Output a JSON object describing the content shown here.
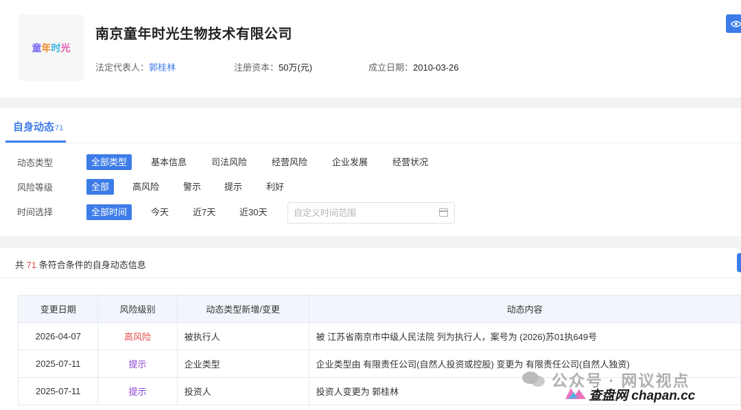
{
  "company": {
    "logo_chars": [
      "童",
      "年",
      "时",
      "光"
    ],
    "name": "南京童年时光生物技术有限公司",
    "legal_rep_label": "法定代表人：",
    "legal_rep": "郭桂林",
    "capital_label": "注册资本：",
    "capital": "50万(元)",
    "founded_label": "成立日期：",
    "founded": "2010-03-26"
  },
  "tab": {
    "label": "自身动态",
    "count": "71"
  },
  "filters": {
    "type_label": "动态类型",
    "type_options": [
      "全部类型",
      "基本信息",
      "司法风险",
      "经营风险",
      "企业发展",
      "经营状况"
    ],
    "risk_label": "风险等级",
    "risk_options": [
      "全部",
      "高风险",
      "警示",
      "提示",
      "利好"
    ],
    "time_label": "时间选择",
    "time_options": [
      "全部时间",
      "今天",
      "近7天",
      "近30天"
    ],
    "date_placeholder": "自定义时间范围"
  },
  "summary": {
    "prefix": "共",
    "count": "71",
    "suffix": "条符合条件的自身动态信息"
  },
  "table": {
    "headers": [
      "变更日期",
      "风险级别",
      "动态类型新增/变更",
      "动态内容"
    ],
    "rows": [
      {
        "date": "2026-04-07",
        "risk": "高风险",
        "type": "被执行人",
        "content": "被 江苏省南京市中级人民法院 列为执行人，案号为 (2026)苏01执649号"
      },
      {
        "date": "2025-07-11",
        "risk": "提示",
        "type": "企业类型",
        "content": "企业类型由 有限责任公司(自然人投资或控股) 变更为 有限责任公司(自然人独资)"
      },
      {
        "date": "2025-07-11",
        "risk": "提示",
        "type": "投资人",
        "content": "投资人变更为 郭桂林"
      }
    ]
  },
  "watermark": {
    "text1": "公众号 · 网议视点",
    "text2": "查盘网 chapan.cc"
  },
  "colors": {
    "accent": "#3d7ce8",
    "high_risk": "#e24a4a",
    "tip": "#8a3fd1"
  }
}
